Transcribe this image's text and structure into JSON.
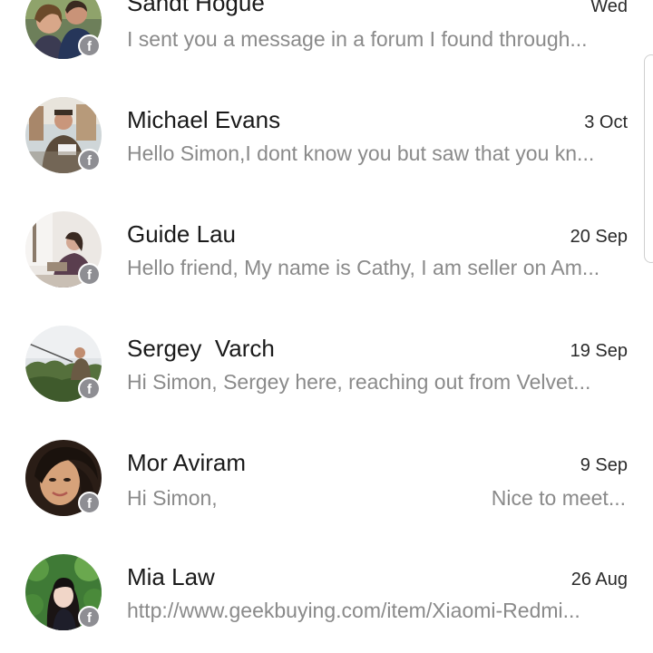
{
  "conversations": [
    {
      "name": "Sandt Hogue",
      "date": "Wed",
      "preview": "I sent you a message in a forum I found through...",
      "avatar_icon": "avatar-couple-photo",
      "badge_icon": "facebook-icon",
      "badge_glyph": "f"
    },
    {
      "name": "Michael Evans",
      "date": "3 Oct",
      "preview": "Hello Simon,I dont know you but saw that you kn...",
      "avatar_icon": "avatar-man-photo",
      "badge_icon": "facebook-icon",
      "badge_glyph": "f"
    },
    {
      "name": "Guide Lau",
      "date": "20 Sep",
      "preview": "Hello friend, My name is Cathy, I am seller on Am...",
      "avatar_icon": "avatar-woman-sitting-photo",
      "badge_icon": "facebook-icon",
      "badge_glyph": "f"
    },
    {
      "name": "Sergey  Varch",
      "date": "19 Sep",
      "preview": "Hi Simon, Sergey here, reaching out from Velvet...",
      "avatar_icon": "avatar-fishing-photo",
      "badge_icon": "facebook-icon",
      "badge_glyph": "f"
    },
    {
      "name": "Mor Aviram",
      "date": "9 Sep",
      "preview_left": "Hi Simon,",
      "preview_right": "Nice to meet...",
      "avatar_icon": "avatar-woman-selfie-photo",
      "badge_icon": "facebook-icon",
      "badge_glyph": "f"
    },
    {
      "name": "Mia Law",
      "date": "26 Aug",
      "preview": "http://www.geekbuying.com/item/Xiaomi-Redmi...",
      "avatar_icon": "avatar-girl-garden-photo",
      "badge_icon": "facebook-icon",
      "badge_glyph": "f"
    }
  ],
  "colors": {
    "name_text": "#1a1a1a",
    "preview_text": "#8a8a8a",
    "badge_bg": "#8e8e93"
  }
}
